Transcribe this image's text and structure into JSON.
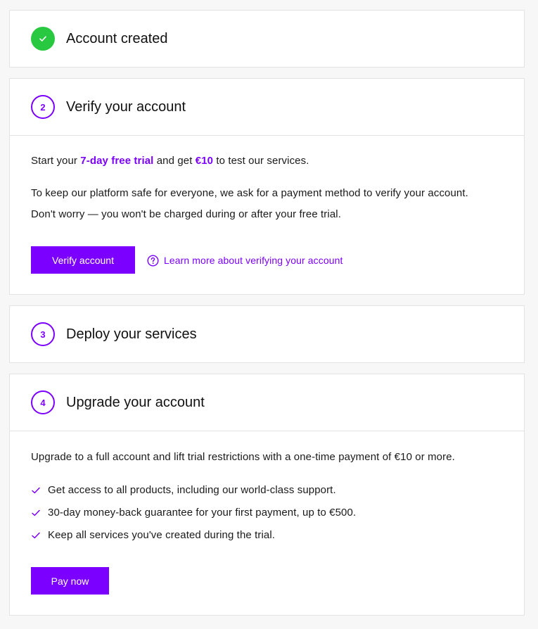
{
  "steps": {
    "created": {
      "title": "Account created"
    },
    "verify": {
      "number": "2",
      "title": "Verify your account",
      "intro_prefix": "Start your ",
      "trial_highlight": "7-day free trial",
      "intro_middle": " and get ",
      "credit_highlight": "€10",
      "intro_suffix": " to test our services.",
      "paragraph_line1": "To keep our platform safe for everyone, we ask for a payment method to verify your account.",
      "paragraph_line2": "Don't worry — you won't be charged during or after your free trial.",
      "button_label": "Verify account",
      "learn_more": "Learn more about verifying your account"
    },
    "deploy": {
      "number": "3",
      "title": "Deploy your services"
    },
    "upgrade": {
      "number": "4",
      "title": "Upgrade your account",
      "intro": "Upgrade to a full account and lift trial restrictions with a one-time payment of €10 or more.",
      "benefits": [
        "Get access to all products, including our world-class support.",
        "30-day money-back guarantee for your first payment, up to €500.",
        "Keep all services you've created during the trial."
      ],
      "button_label": "Pay now"
    }
  },
  "colors": {
    "accent": "#7b00ff",
    "success": "#28c840",
    "border": "#e3e3e3",
    "background": "#f7f7f7"
  },
  "icons": {
    "done": "check-icon",
    "help": "question-circle-icon",
    "benefit": "checkmark-icon"
  }
}
